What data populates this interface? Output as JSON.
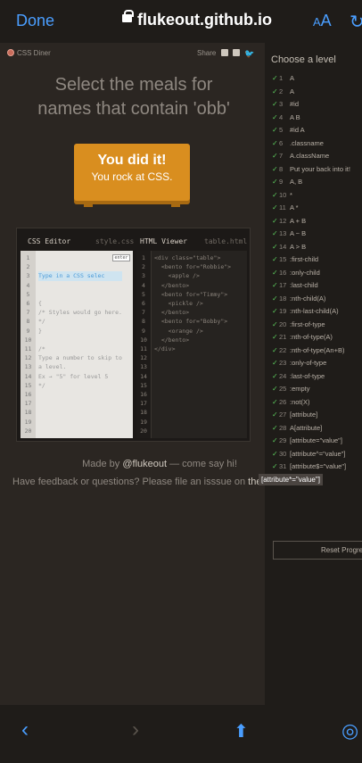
{
  "browser": {
    "done_label": "Done",
    "url": "flukeout.github.io",
    "aa_label": "AA",
    "reload_icon": "reload-icon",
    "accent": "#4a9eff"
  },
  "game": {
    "brand": "CSS Diner",
    "share_label": "Share",
    "instruction_line1": "Select the meals for",
    "instruction_line2": "names that contain 'obb'",
    "table_line1": "You did it!",
    "table_line2": "You rock at CSS.",
    "editor": {
      "css_title": "CSS Editor",
      "css_file": "style.css",
      "html_title": "HTML Viewer",
      "html_file": "table.html",
      "input_placeholder": "Type in a CSS selec",
      "enter_label": "enter",
      "css_code": "{\n/* Styles would go here.\n*/\n}\n\n/*\nType a number to skip to\na level.\nEx → \"5\" for level 5\n*/",
      "html_code": "<div class=\"table\">\n  <bento for=\"Robbie\">\n    <apple />\n  </bento>\n  <bento for=\"Timmy\">\n    <pickle />\n  </bento>\n  <bento for=\"Bobby\">\n    <orange />\n  </bento>\n</div>",
      "line_numbers": "1\n2\n3\n4\n5\n6\n7\n8\n9\n10\n11\n12\n13\n14\n15\n16\n17\n18\n19\n20"
    },
    "made_by_prefix": "Made by ",
    "made_by_handle": "@flukeout",
    "made_by_suffix": " — come say hi!",
    "feedback_text": "Have feedback or questions? Please file an isssue on ",
    "feedback_link": "the Github repo"
  },
  "sidebar": {
    "title": "Choose a level",
    "levels": [
      {
        "n": "1",
        "name": "A"
      },
      {
        "n": "2",
        "name": "A"
      },
      {
        "n": "3",
        "name": "#id"
      },
      {
        "n": "4",
        "name": "A B"
      },
      {
        "n": "5",
        "name": "#id A"
      },
      {
        "n": "6",
        "name": ".classname"
      },
      {
        "n": "7",
        "name": "A.className"
      },
      {
        "n": "8",
        "name": "Put your back into it!"
      },
      {
        "n": "9",
        "name": "A, B"
      },
      {
        "n": "10",
        "name": "*"
      },
      {
        "n": "11",
        "name": "A *"
      },
      {
        "n": "12",
        "name": "A + B"
      },
      {
        "n": "13",
        "name": "A ~ B"
      },
      {
        "n": "14",
        "name": "A > B"
      },
      {
        "n": "15",
        "name": ":first-child"
      },
      {
        "n": "16",
        "name": ":only-child"
      },
      {
        "n": "17",
        "name": ":last-child"
      },
      {
        "n": "18",
        "name": ":nth-child(A)"
      },
      {
        "n": "19",
        "name": ":nth-last-child(A)"
      },
      {
        "n": "20",
        "name": ":first-of-type"
      },
      {
        "n": "21",
        "name": ":nth-of-type(A)"
      },
      {
        "n": "22",
        "name": ":nth-of-type(An+B)"
      },
      {
        "n": "23",
        "name": ":only-of-type"
      },
      {
        "n": "24",
        "name": ":last-of-type"
      },
      {
        "n": "25",
        "name": ":empty"
      },
      {
        "n": "26",
        "name": ":not(X)"
      },
      {
        "n": "27",
        "name": "[attribute]"
      },
      {
        "n": "28",
        "name": "A[attribute]"
      },
      {
        "n": "29",
        "name": "[attribute=\"value\"]"
      },
      {
        "n": "30",
        "name": "[attribute^=\"value\"]"
      },
      {
        "n": "31",
        "name": "[attribute$=\"value\"]"
      }
    ],
    "tooltip": "[attribute*=\"value\"]",
    "reset_label": "Reset Progress"
  }
}
